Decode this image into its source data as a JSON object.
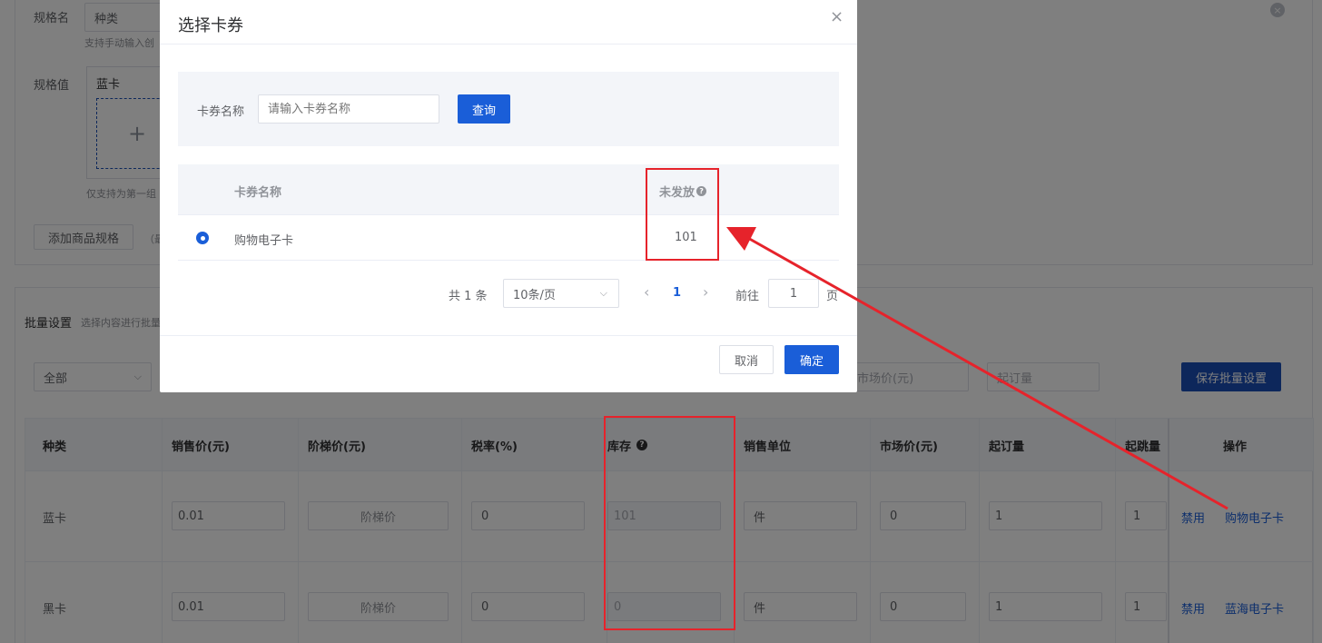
{
  "background": {
    "spec_name_label": "规格名",
    "spec_name_value": "种类",
    "spec_name_tip": "支持手动输入创",
    "spec_value_label": "规格值",
    "spec_value_item": "蓝卡",
    "upload_plus": "+",
    "spec_value_tip": "仅支持为第一组",
    "add_spec_button": "添加商品规格",
    "add_spec_tip": "（最",
    "batch_title": "批量设置",
    "batch_tip": "选择内容进行批量",
    "batch_select_value": "全部",
    "market_price_placeholder": "市场价(元)",
    "min_order_placeholder": "起订量",
    "save_batch_button": "保存批量设置",
    "table_headers": [
      "种类",
      "销售价(元)",
      "阶梯价(元)",
      "税率(%)",
      "库存",
      "销售单位",
      "市场价(元)",
      "起订量",
      "起跳量",
      "操作"
    ],
    "rows": [
      {
        "kind": "蓝卡",
        "price": "0.01",
        "tier": "阶梯价",
        "tax": "0",
        "stock": "101",
        "unit": "件",
        "market": "0",
        "min_order": "1",
        "step": "1",
        "action_disable": "禁用",
        "action_card": "购物电子卡"
      },
      {
        "kind": "黑卡",
        "price": "0.01",
        "tier": "阶梯价",
        "tax": "0",
        "stock": "0",
        "unit": "件",
        "market": "0",
        "min_order": "1",
        "step": "1",
        "action_disable": "禁用",
        "action_card": "蓝海电子卡"
      }
    ]
  },
  "dialog": {
    "title": "选择卡券",
    "close_icon": "×",
    "search_label": "卡券名称",
    "search_placeholder": "请输入卡券名称",
    "query_button": "查询",
    "table_headers": {
      "name": "卡券名称",
      "unissued": "未发放"
    },
    "rows": [
      {
        "name": "购物电子卡",
        "unissued": "101",
        "selected": true
      }
    ],
    "pagination": {
      "total": "共 1 条",
      "page_size": "10条/页",
      "prev": "‹",
      "current": "1",
      "next": "›",
      "goto_label": "前往",
      "goto_value": "1",
      "page_suffix": "页"
    },
    "cancel_button": "取消",
    "confirm_button": "确定"
  },
  "colors": {
    "primary": "#1a5ed8",
    "annotation_red": "#e6232b"
  }
}
